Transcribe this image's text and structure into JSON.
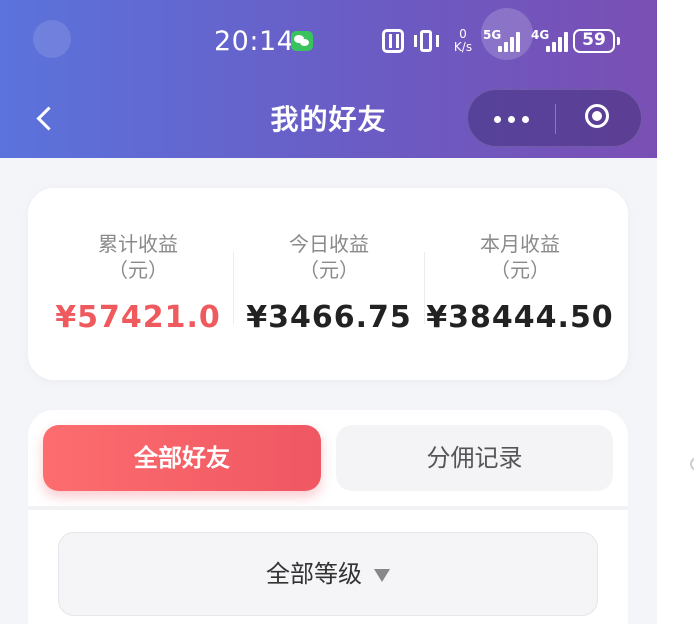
{
  "status_bar": {
    "time": "20:14",
    "speed_value": "0",
    "speed_unit": "K/s",
    "net1": "5G",
    "net2": "4G",
    "battery": "59"
  },
  "nav": {
    "title": "我的好友"
  },
  "earnings": {
    "total_label": "累计收益（元）",
    "total_value": "¥57421.0",
    "today_label": "今日收益（元）",
    "today_value": "¥3466.75",
    "month_label": "本月收益（元）",
    "month_value": "¥38444.50"
  },
  "tabs": [
    {
      "label": "全部好友",
      "active": true
    },
    {
      "label": "分佣记录",
      "active": false
    }
  ],
  "filter": {
    "level_label": "全部等级"
  },
  "colors": {
    "header_start": "#5b73dc",
    "header_end": "#7a4fb4",
    "accent_red": "#ef5a5e"
  },
  "icons": [
    "wechat-icon",
    "nfc-icon",
    "vibrate-icon",
    "signal-icon",
    "battery-icon",
    "back-arrow-icon",
    "more-dots-icon",
    "close-circle-icon",
    "dropdown-arrow-icon"
  ]
}
